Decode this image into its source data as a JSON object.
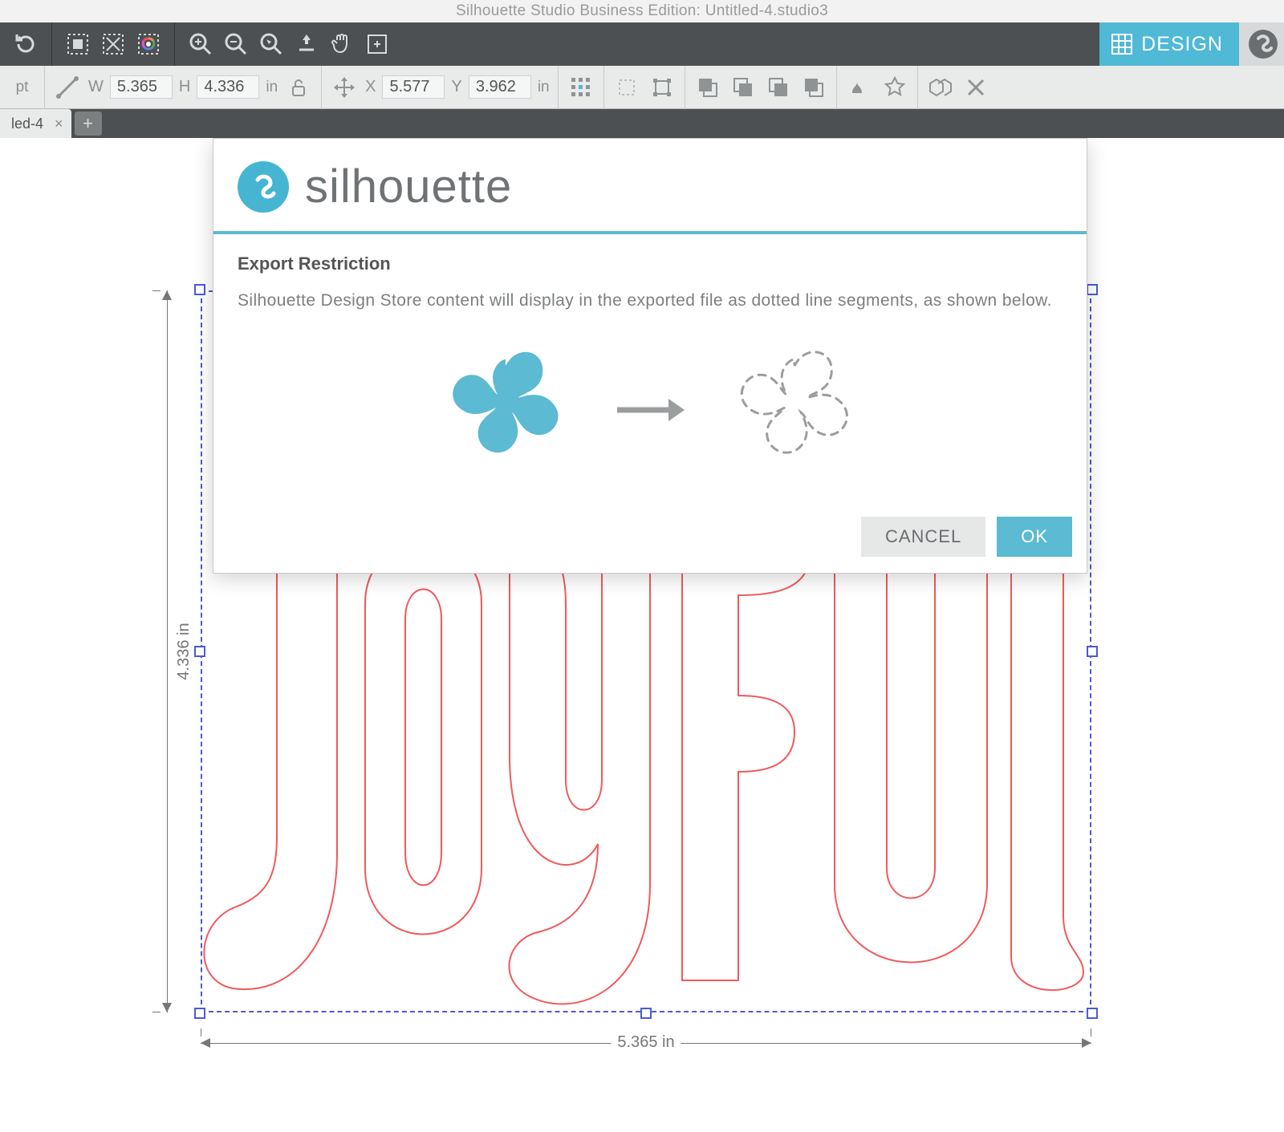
{
  "window": {
    "title": "Silhouette Studio Business Edition: Untitled-4.studio3"
  },
  "designTab": {
    "label": "DESIGN"
  },
  "properties": {
    "pt_unit": "pt",
    "W_label": "W",
    "W_value": "5.365",
    "H_label": "H",
    "H_value": "4.336",
    "WH_unit": "in",
    "X_label": "X",
    "X_value": "5.577",
    "Y_label": "Y",
    "Y_value": "3.962",
    "XY_unit": "in"
  },
  "tabs": {
    "doc_name": "led-4",
    "close": "×",
    "new": "+"
  },
  "selection": {
    "width_label": "5.365 in",
    "height_label": "4.336 in"
  },
  "dialog": {
    "brand": "silhouette",
    "title": "Export Restriction",
    "message": "Silhouette Design Store content will display in the exported file as dotted line segments, as shown below.",
    "cancel": "CANCEL",
    "ok": "OK"
  }
}
